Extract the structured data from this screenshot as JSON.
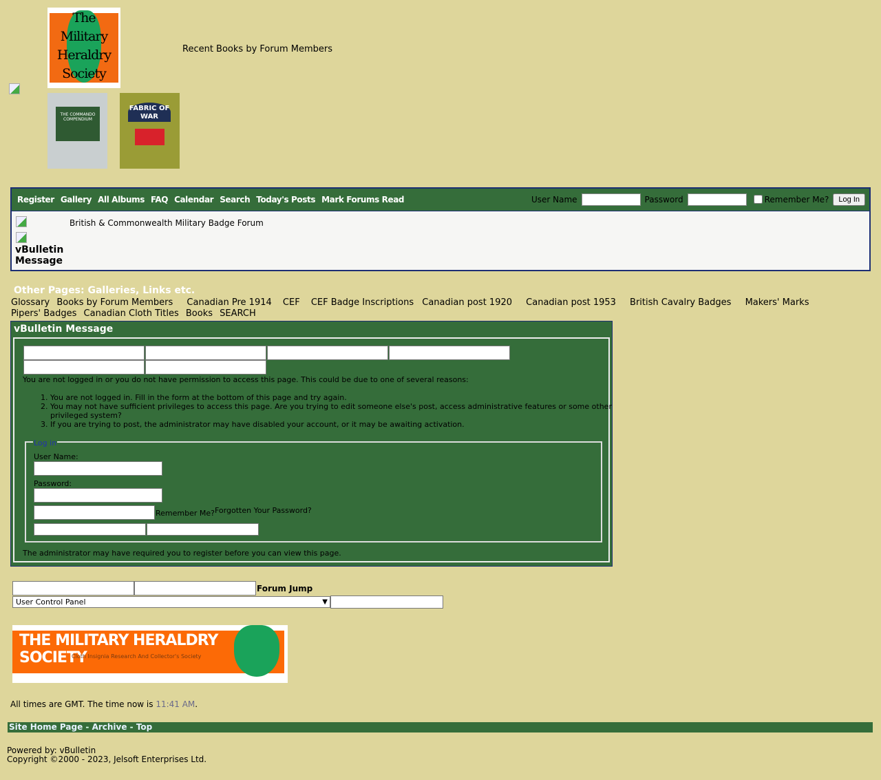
{
  "header": {
    "recent_books_title": "Recent Books by Forum Members",
    "logo_text": "The Military Heraldry Society",
    "book1_text": "THE COMMANDO COMPENDIUM",
    "book2_text": "FABRIC OF WAR"
  },
  "navbar": {
    "links": [
      "Register",
      "Gallery",
      "All Albums",
      "FAQ",
      "Calendar",
      "Search",
      "Today's Posts",
      "Mark Forums Read"
    ],
    "login": {
      "username_label": "User Name",
      "password_label": "Password",
      "remember_label": "Remember Me?",
      "login_button": "Log In"
    }
  },
  "forum": {
    "breadcrumb": "British & Commonwealth Military Badge Forum",
    "message_title": "vBulletin Message"
  },
  "other_pages": {
    "title": "Other Pages: Galleries, Links etc.",
    "links": [
      "Glossary",
      "Books by Forum Members",
      "Canadian Pre 1914",
      "CEF",
      "CEF Badge Inscriptions",
      "Canadian post 1920",
      "Canadian post 1953",
      "British Cavalry Badges",
      "Makers' Marks",
      "Pipers' Badges",
      "Canadian Cloth Titles",
      "Books",
      "SEARCH"
    ]
  },
  "message": {
    "title": "vBulletin Message",
    "intro": "You are not logged in or you do not have permission to access this page. This could be due to one of several reasons:",
    "reasons": [
      "You are not logged in. Fill in the form at the bottom of this page and try again.",
      "You may not have sufficient privileges to access this page. Are you trying to edit someone else's post, access administrative features or some other privileged system?",
      "If you are trying to post, the administrator may have disabled your account, or it may be awaiting activation."
    ],
    "login_legend": "Log in",
    "username_label": "User Name:",
    "password_label": "Password:",
    "remember_label": "Remember Me?",
    "forgot_label": "Forgotten Your Password?",
    "footer": "The administrator may have required you to register before you can view this page."
  },
  "jump": {
    "label": "Forum Jump",
    "selected": "User Control Panel"
  },
  "banner": {
    "title": "THE MILITARY HERALDRY SOCIETY",
    "subtitle": "Cloth Insignia Research And Collector's Society"
  },
  "time": {
    "prefix": "All times are GMT. The time now is ",
    "value": "11:41 AM",
    "suffix": "."
  },
  "footer_links": [
    "Site Home Page",
    "Archive",
    "Top"
  ],
  "copyright": {
    "powered": "Powered by: vBulletin",
    "copyright": "Copyright ©2000 - 2023, Jelsoft Enterprises Ltd."
  },
  "colors": {
    "background": "#ded69b",
    "green": "#356d3a",
    "border": "#1c2e74"
  }
}
